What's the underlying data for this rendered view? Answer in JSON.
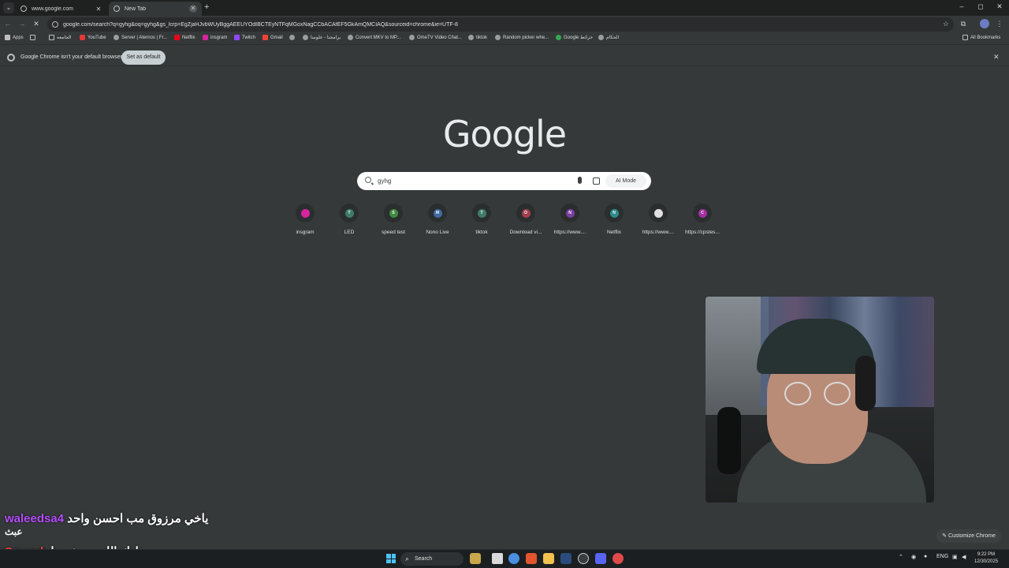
{
  "tabs": [
    {
      "label": "www.google.com",
      "active": false
    },
    {
      "label": "New Tab",
      "active": true
    }
  ],
  "window": {
    "minimize": "–",
    "maximize": "◻",
    "close": "✕"
  },
  "toolbar": {
    "url": "google.com/search?q=gyhg&oq=gyhg&gs_lcrp=EgZjaHJvbWUyBggAEEUYOdIBCTEyNTFqMGoxNagCCbACAfEF5GkAmQMCIAQ&sourceid=chrome&ie=UTF-8"
  },
  "bookmarks": {
    "apps": "Apps",
    "items": [
      {
        "label": "الجامعه",
        "icon": "folder"
      },
      {
        "label": "YouTube",
        "icon": "yt"
      },
      {
        "label": "Server | Aternos | Fr...",
        "icon": "globe"
      },
      {
        "label": "Netflix",
        "icon": "nf"
      },
      {
        "label": "insgram",
        "icon": "ig"
      },
      {
        "label": "Twitch",
        "icon": "tw"
      },
      {
        "label": "Gmail",
        "icon": "gm"
      },
      {
        "label": "",
        "icon": "globe"
      },
      {
        "label": "برامجنا - علومنا",
        "icon": "globe"
      },
      {
        "label": "Convert MKV to MP...",
        "icon": "globe"
      },
      {
        "label": "OmeTV Video Chat...",
        "icon": "globe"
      },
      {
        "label": "tiktok",
        "icon": "globe"
      },
      {
        "label": "Random picker whe...",
        "icon": "globe"
      },
      {
        "label": "Google خرائط",
        "icon": "map"
      },
      {
        "label": "الحكام",
        "icon": "globe"
      }
    ],
    "all_bookmarks": "All Bookmarks"
  },
  "infobar": {
    "message": "Google Chrome isn't your default browser",
    "button": "Set as default"
  },
  "ntp": {
    "logo": "Google",
    "query": "gyhg",
    "ai_mode": "AI Mode",
    "customize": "Customize Chrome",
    "shortcuts": [
      {
        "label": "insgram",
        "letter": "",
        "color": "#d6249f"
      },
      {
        "label": "LED",
        "letter": "T",
        "color": "#3f7d6a"
      },
      {
        "label": "speed test",
        "letter": "S",
        "color": "#3f8a3f"
      },
      {
        "label": "Nono Live",
        "letter": "M",
        "color": "#3f6aa3"
      },
      {
        "label": "tiktok",
        "letter": "T",
        "color": "#3f7d6a"
      },
      {
        "label": "Download vi...",
        "letter": "O",
        "color": "#a33f4f"
      },
      {
        "label": "https://www....",
        "letter": "N",
        "color": "#7a3fa3"
      },
      {
        "label": "Netflix",
        "letter": "N",
        "color": "#2f8a8a"
      },
      {
        "label": "https://www....",
        "letter": "",
        "color": "#e0e0e0"
      },
      {
        "label": "https://cpstes...",
        "letter": "C",
        "color": "#a32fa3"
      }
    ]
  },
  "chat": [
    {
      "user": "waleedsa4",
      "message": "ياخي مرزوق مب احسن واحد",
      "continuation": "عبث"
    },
    {
      "user": "Sqwerh",
      "message": "زادك الله من خيرها"
    }
  ],
  "taskbar": {
    "search": "Search",
    "lang": "ENG",
    "time": "9:22 PM",
    "date": "12/30/2025"
  }
}
